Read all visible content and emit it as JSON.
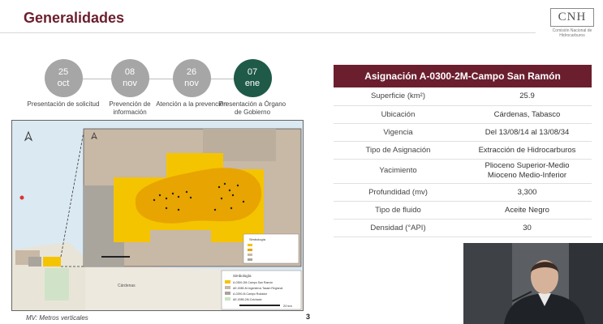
{
  "slide": {
    "title": "Generalidades",
    "page_number": "3",
    "footnote": "MV: Metros verticales"
  },
  "logo": {
    "text": "CNH",
    "subtitle": "Comisión Nacional de Hidrocarburos"
  },
  "timeline": [
    {
      "day": "25",
      "month": "oct",
      "label": "Presentación de solicitud",
      "active": false
    },
    {
      "day": "08",
      "month": "nov",
      "label": "Prevención de información",
      "active": false
    },
    {
      "day": "26",
      "month": "nov",
      "label": "Atención a la prevención",
      "active": false
    },
    {
      "day": "07",
      "month": "ene",
      "label": "Presentación a Órgano de Gobierno",
      "active": true
    }
  ],
  "table": {
    "title": "Asignación A-0300-2M-Campo San Ramón",
    "rows": [
      {
        "label": "Superficie (km²)",
        "value": "25.9"
      },
      {
        "label": "Ubicación",
        "value": "Cárdenas, Tabasco"
      },
      {
        "label": "Vigencia",
        "value": "Del 13/08/14 al 13/08/34"
      },
      {
        "label": "Tipo de Asignación",
        "value": "Extracción de Hidrocarburos"
      },
      {
        "label": "Yacimiento",
        "value": "Plioceno Superior-Medio\nMioceno Medio-Inferior"
      },
      {
        "label": "Profundidad (mv)",
        "value": "3,300"
      },
      {
        "label": "Tipo de fluido",
        "value": "Aceite Negro"
      },
      {
        "label": "Densidad (°API)",
        "value": "30"
      }
    ]
  },
  "map": {
    "inset_legend_title": "Simbología",
    "main_legend_title": "Simbología",
    "main_legend_items": [
      "A-0300-2M-Campo San Ramón",
      "AE-0080-M-Ingenieros Tasam Regional",
      "A-0290-M-Campo Rodador",
      "AE-0089-2M-Colchado"
    ],
    "place_label": "Cárdenas",
    "scale_label": "20 km",
    "colors": {
      "assignment": "#f5c400",
      "field": "#e8a400",
      "area_a": "#c8b8a6",
      "area_b": "#a9a59c",
      "water": "#dbe9f2",
      "wells": "#222222"
    }
  }
}
